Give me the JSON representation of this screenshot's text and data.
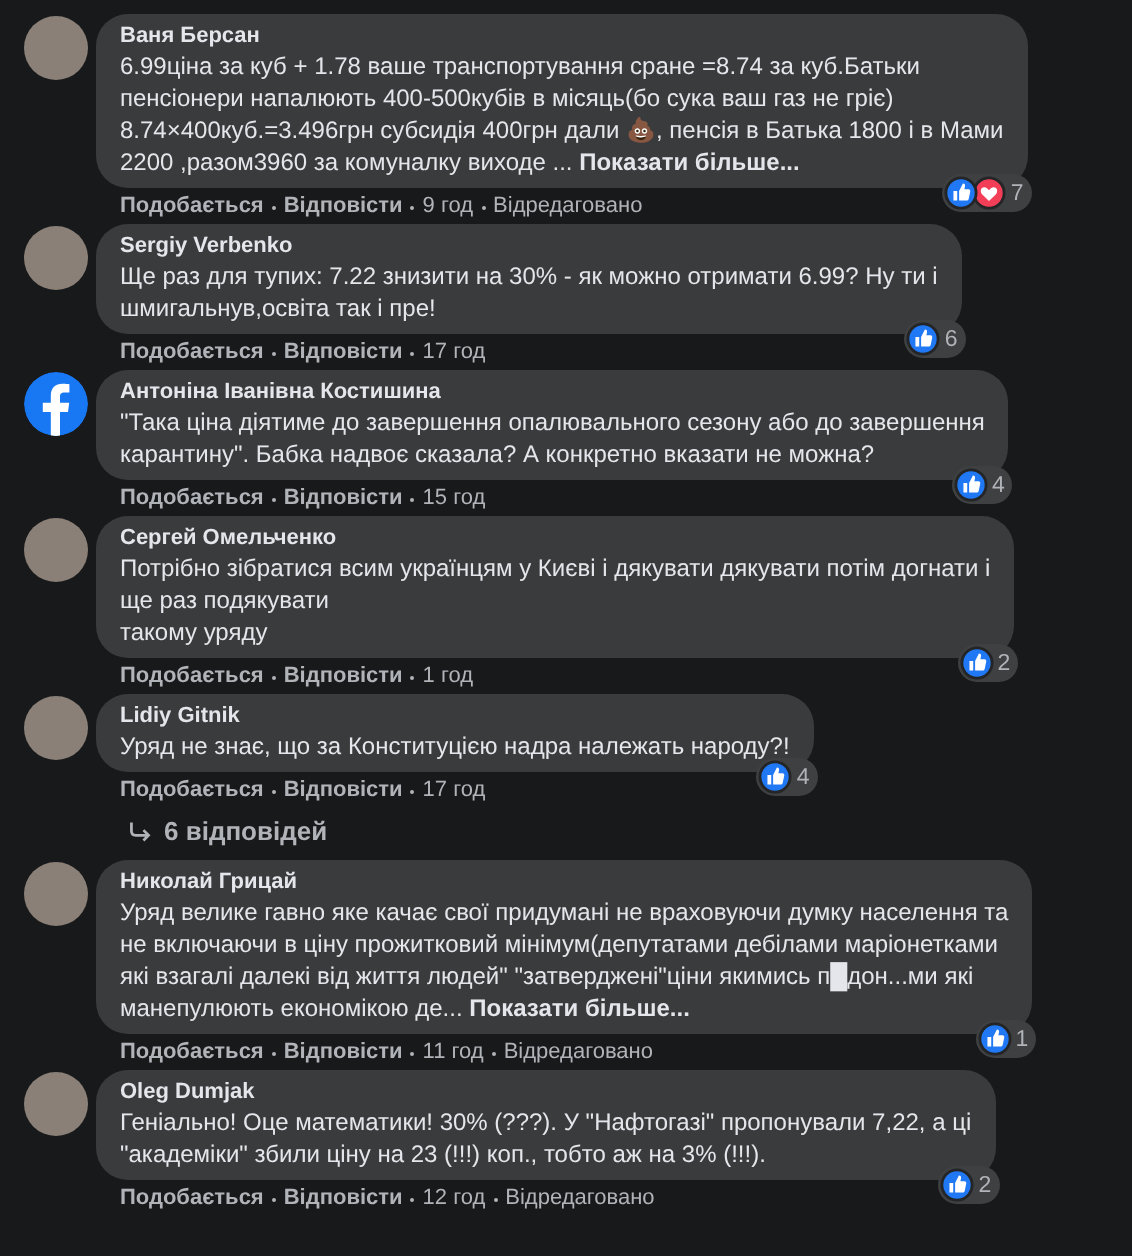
{
  "comments": [
    {
      "author": "Ваня Берсан",
      "avatar": {
        "kind": "photo"
      },
      "lines": [
        "6.99ціна за куб + 1.78 ваше транспортування сране =8.74 за куб.Батьки",
        "пенсіонери напалюють 400-500кубів в місяць(бо сука ваш газ не гріє)",
        "8.74×400куб.=3.496грн субсидія 400грн дали 💩, пенсія в Батька 1800 і в Мами",
        "2200 ,разом3960 за комуналку виходе ... **Показати більше...**"
      ],
      "reactions": [
        {
          "kind": "like"
        },
        {
          "kind": "love"
        }
      ],
      "reaction_count": "7",
      "like": "Подобається",
      "reply": "Відповісти",
      "time": "9 год",
      "edited": "Відредаговано"
    },
    {
      "author": "Sergiy Verbenko",
      "avatar": {
        "kind": "photo"
      },
      "lines": [
        "Ще раз для тупих: 7.22 знизити на 30% - як можно отримати 6.99? Ну ти і",
        "шмигальнув,освіта так і пре!"
      ],
      "reactions": [
        {
          "kind": "like"
        }
      ],
      "reaction_count": "6",
      "like": "Подобається",
      "reply": "Відповісти",
      "time": "17 год"
    },
    {
      "author": "Антоніна Іванівна Костишина",
      "avatar": {
        "kind": "facebook"
      },
      "lines": [
        "\"Така ціна діятиме до завершення опалювального сезону або до завершення",
        "карантину\". Бабка надвоє сказала? А конкретно вказати не можна?"
      ],
      "reactions": [
        {
          "kind": "like"
        }
      ],
      "reaction_count": "4",
      "like": "Подобається",
      "reply": "Відповісти",
      "time": "15 год"
    },
    {
      "author": "Сергей Омельченко",
      "avatar": {
        "kind": "photo"
      },
      "lines": [
        "Потрібно зібратися всим українцям у Києві і дякувати дякувати потім догнати і",
        "ще раз подякувати",
        "такому уряду"
      ],
      "reactions": [
        {
          "kind": "like"
        }
      ],
      "reaction_count": "2",
      "like": "Подобається",
      "reply": "Відповісти",
      "time": "1 год"
    },
    {
      "author": "Lidiy Gitnik",
      "avatar": {
        "kind": "photo"
      },
      "lines": [
        "Уряд не знає, що за Конституцією надра належать народу?!"
      ],
      "reactions": [
        {
          "kind": "like"
        }
      ],
      "reaction_count": "4",
      "like": "Подобається",
      "reply": "Відповісти",
      "time": "17 год",
      "replies": "6 відповідей"
    },
    {
      "author": "Николай Грицай",
      "avatar": {
        "kind": "photo"
      },
      "lines": [
        "Уряд велике гавно яке качає свої придумані не враховуючи думку населення та",
        "не включаючи в ціну прожитковий мінімум(депутатами дебілами маріонетками",
        "які взагалі далекі від життя людей\" \"затверджені\"ціни якимись п█дон...ми які",
        "манепулюють економікою де... **Показати більше...**"
      ],
      "reactions": [
        {
          "kind": "like"
        }
      ],
      "reaction_count": "1",
      "like": "Подобається",
      "reply": "Відповісти",
      "time": "11 год",
      "edited": "Відредаговано"
    },
    {
      "author": "Oleg Dumjak",
      "avatar": {
        "kind": "photo"
      },
      "lines": [
        "Геніально! Оце математики! 30% (???). У \"Нафтогазі\" пропонували 7,22, а ці",
        "\"академіки\" збили ціну на 23 (!!!) коп., тобто аж на 3% (!!!)."
      ],
      "reactions": [
        {
          "kind": "like"
        }
      ],
      "reaction_count": "2",
      "like": "Подобається",
      "reply": "Відповісти",
      "time": "12 год",
      "edited": "Відредаговано"
    }
  ]
}
